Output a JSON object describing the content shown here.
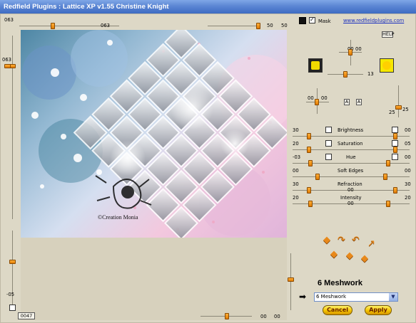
{
  "window": {
    "title": "Redfield Plugins : Lattice XP v1.55   Christine Knight"
  },
  "top": {
    "left_value": "063",
    "mid_value": "063",
    "right_value_1": "50",
    "right_value_2": "50"
  },
  "mask": {
    "label": "Mask",
    "checked": true
  },
  "link": {
    "text": "www.redfieldplugins.com"
  },
  "help_label": "HELP",
  "left_values": {
    "top": "063",
    "bottom": "-05"
  },
  "light_pad": {
    "v1": "00",
    "v2": "00",
    "value": "13"
  },
  "colors": {
    "swatch1": "#222222",
    "swatch2": "#f6e800",
    "brand": "#f0a000"
  },
  "offset_pad": {
    "v1": "00",
    "v2": "00",
    "value_a": "25",
    "value_b": "25",
    "btn_a": "A",
    "btn_b": "A"
  },
  "params": [
    {
      "label": "Brightness",
      "left": "30",
      "right": "00"
    },
    {
      "label": "Saturation",
      "left": "20",
      "right": "05"
    },
    {
      "label": "Hue",
      "left": "-03",
      "right": "00"
    },
    {
      "label": "Soft Edges",
      "left": "00",
      "right": "00"
    },
    {
      "label": "Refraction",
      "left": "30",
      "right": "30"
    },
    {
      "label": "Intensity",
      "left": "20",
      "right": "20"
    }
  ],
  "center_marks": [
    "00",
    "00"
  ],
  "bottom": {
    "coord": "0047",
    "right_value_1": "00",
    "right_value_2": "00"
  },
  "preset": {
    "heading": "6 Meshwork",
    "selected": "6 Meshwork"
  },
  "buttons": {
    "cancel": "Cancel",
    "apply": "Apply"
  },
  "preview_image": {
    "watermark": "©Creation Monia"
  }
}
